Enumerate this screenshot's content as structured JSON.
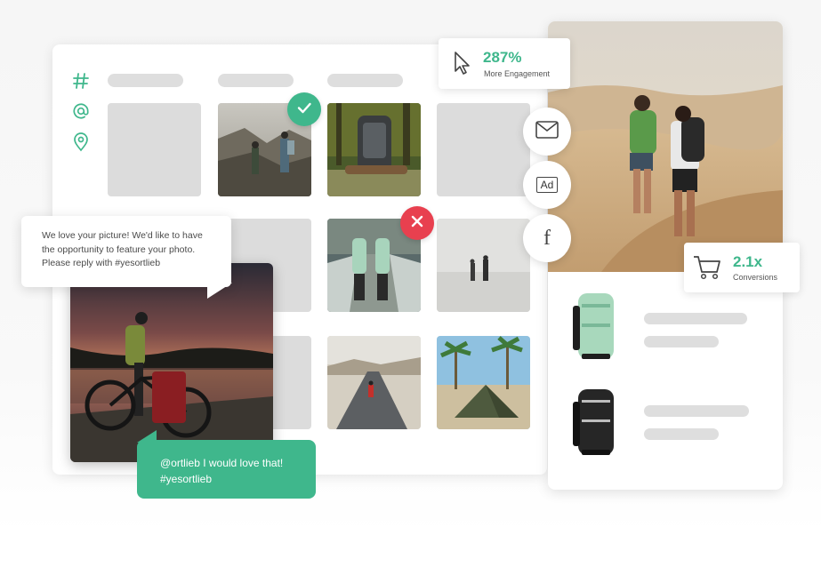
{
  "sidebar": {
    "icons": [
      "hashtag-icon",
      "at-icon",
      "location-pin-icon"
    ],
    "hashtag_glyph": "#",
    "at_glyph": "@"
  },
  "colors": {
    "accent": "#3fb78c",
    "reject": "#e8404f",
    "placeholder": "#dcdcdc"
  },
  "comment_request": {
    "lines": [
      "We love your picture! We'd like to have",
      "the opportunity to feature your photo.",
      "Please reply with #yesortlieb"
    ]
  },
  "reply": {
    "lines": [
      "@ortlieb I would love that!",
      "#yesortlieb"
    ]
  },
  "engagement_stat": {
    "value": "287%",
    "label": "More Engagement",
    "icon": "cursor-icon"
  },
  "conversion_stat": {
    "value": "2.1x",
    "label": "Conversions",
    "icon": "cart-icon"
  },
  "channels": [
    {
      "name": "email",
      "icon": "mail-icon"
    },
    {
      "name": "ad",
      "icon": "ad-icon",
      "label": "Ad"
    },
    {
      "name": "facebook",
      "icon": "facebook-icon",
      "label": "f"
    }
  ],
  "badges": {
    "approve_icon": "check-icon",
    "reject_icon": "close-icon"
  }
}
